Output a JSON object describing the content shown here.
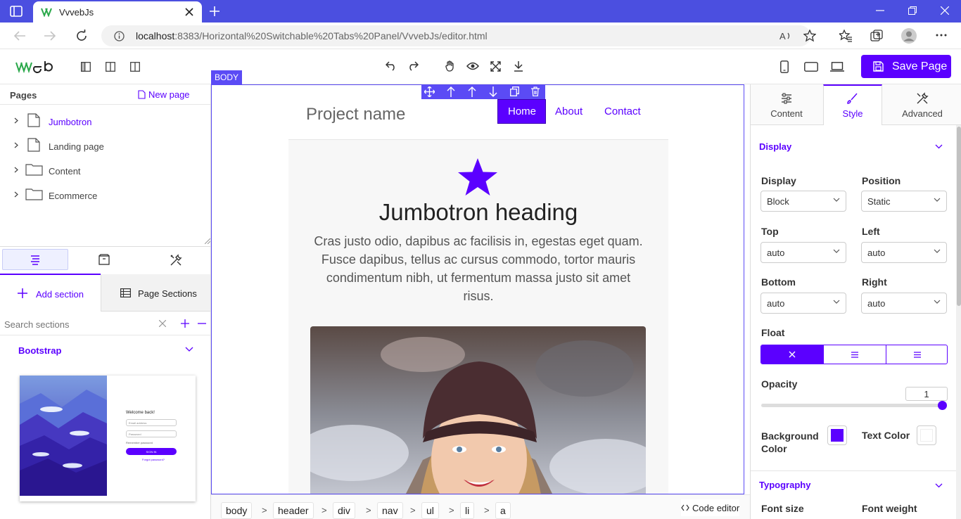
{
  "browser": {
    "tab_title": "VvvebJs",
    "url_host": "localhost",
    "url_rest": ":8383/Horizontal%20Switchable%20Tabs%20Panel/VvvebJs/editor.html"
  },
  "toolbar": {
    "save_label": "Save Page"
  },
  "pages_panel": {
    "title": "Pages",
    "new_page_label": "New page",
    "items": [
      {
        "label": "Jumbotron",
        "type": "file",
        "active": true
      },
      {
        "label": "Landing page",
        "type": "file",
        "active": false
      },
      {
        "label": "Content",
        "type": "folder",
        "active": false
      },
      {
        "label": "Ecommerce",
        "type": "folder",
        "active": false
      }
    ]
  },
  "sections_panel": {
    "add_section_label": "Add section",
    "page_sections_label": "Page Sections",
    "search_placeholder": "Search sections",
    "group_label": "Bootstrap",
    "thumb": {
      "welcome": "Welcome back!",
      "email": "Email address",
      "password": "Password",
      "remember": "Remember password",
      "signin": "SIGN IN",
      "forgot": "Forgot password?"
    }
  },
  "canvas": {
    "body_badge": "BODY",
    "brand": "Project name",
    "nav": [
      "Home",
      "About",
      "Contact"
    ],
    "heading": "Jumbotron heading",
    "paragraph": "Cras justo odio, dapibus ac facilisis in, egestas eget quam. Fusce dapibus, tellus ac cursus commodo, tortor mauris condimentum nibh, ut fermentum massa justo sit amet risus."
  },
  "breadcrumb": [
    "body",
    "header",
    "div",
    "nav",
    "ul",
    "li",
    "a"
  ],
  "code_editor_label": "Code editor",
  "right_panel": {
    "tabs": [
      "Content",
      "Style",
      "Advanced"
    ],
    "display_section": "Display",
    "display_label": "Display",
    "display_value": "Block",
    "position_label": "Position",
    "position_value": "Static",
    "top_label": "Top",
    "top_value": "auto",
    "left_label": "Left",
    "left_value": "auto",
    "bottom_label": "Bottom",
    "bottom_value": "auto",
    "right_label": "Right",
    "right_value": "auto",
    "float_label": "Float",
    "opacity_label": "Opacity",
    "opacity_value": "1",
    "bg_color_label_1": "Background",
    "bg_color_label_2": "Color",
    "text_color_label": "Text Color",
    "typography_section": "Typography",
    "font_size_label": "Font size",
    "font_weight_label": "Font weight"
  },
  "colors": {
    "accent": "#5b00ff",
    "browser_chrome": "#4b4fe0"
  }
}
